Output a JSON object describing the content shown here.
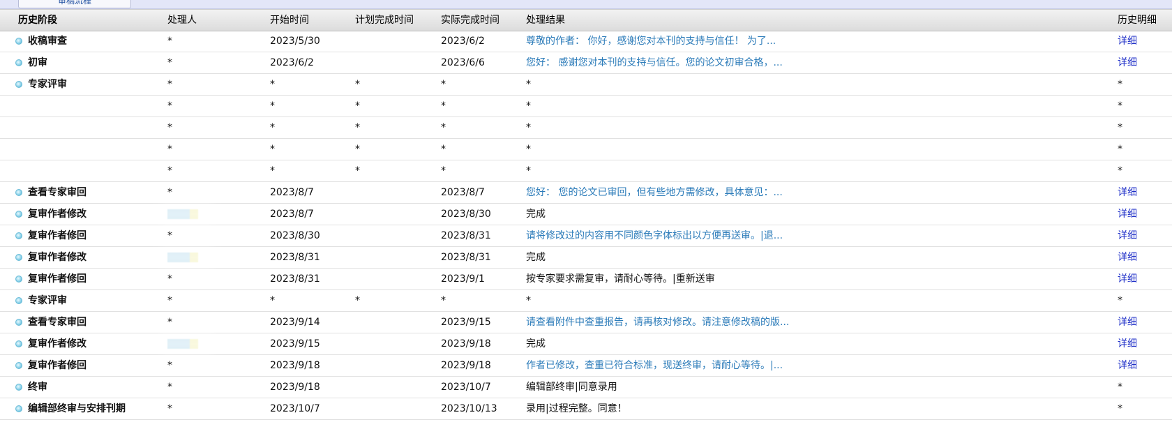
{
  "tabs": {
    "active_label": "审稿流程"
  },
  "columns": {
    "stage": "历史阶段",
    "handler": "处理人",
    "start": "开始时间",
    "planned": "计划完成时间",
    "actual": "实际完成时间",
    "result": "处理结果",
    "detail": "历史明细"
  },
  "rows": [
    {
      "stage": "收稿审查",
      "handler": "*",
      "start": "2023/5/30",
      "planned": "",
      "actual": "2023/6/2",
      "result": "尊敬的作者： 你好，感谢您对本刊的支持与信任！ 为了...",
      "result_link": true,
      "detail": "详细"
    },
    {
      "stage": "初审",
      "handler": "*",
      "start": "2023/6/2",
      "planned": "",
      "actual": "2023/6/6",
      "result": "您好： 感谢您对本刊的支持与信任。您的论文初审合格，...",
      "result_link": true,
      "detail": "详细"
    },
    {
      "stage": "专家评审",
      "handler": "*",
      "start": "*",
      "planned": "*",
      "actual": "*",
      "result": "*",
      "result_link": false,
      "detail": "*"
    },
    {
      "stage": "",
      "handler": "*",
      "start": "*",
      "planned": "*",
      "actual": "*",
      "result": "*",
      "result_link": false,
      "detail": "*"
    },
    {
      "stage": "",
      "handler": "*",
      "start": "*",
      "planned": "*",
      "actual": "*",
      "result": "*",
      "result_link": false,
      "detail": "*"
    },
    {
      "stage": "",
      "handler": "*",
      "start": "*",
      "planned": "*",
      "actual": "*",
      "result": "*",
      "result_link": false,
      "detail": "*"
    },
    {
      "stage": "",
      "handler": "*",
      "start": "*",
      "planned": "*",
      "actual": "*",
      "result": "*",
      "result_link": false,
      "detail": "*"
    },
    {
      "stage": "查看专家审回",
      "handler": "*",
      "start": "2023/8/7",
      "planned": "",
      "actual": "2023/8/7",
      "result": "您好： 您的论文已审回，但有些地方需修改，具体意见：...",
      "result_link": true,
      "detail": "详细"
    },
    {
      "stage": "复审作者修改",
      "handler": "",
      "handler_redacted": true,
      "start": "2023/8/7",
      "planned": "",
      "actual": "2023/8/30",
      "result": "完成",
      "result_link": false,
      "detail": "详细"
    },
    {
      "stage": "复审作者修回",
      "handler": "*",
      "start": "2023/8/30",
      "planned": "",
      "actual": "2023/8/31",
      "result": "请将修改过的内容用不同颜色字体标出以方便再送审。|退...",
      "result_link": true,
      "detail": "详细"
    },
    {
      "stage": "复审作者修改",
      "handler": "",
      "handler_redacted": true,
      "start": "2023/8/31",
      "planned": "",
      "actual": "2023/8/31",
      "result": "完成",
      "result_link": false,
      "detail": "详细"
    },
    {
      "stage": "复审作者修回",
      "handler": "*",
      "start": "2023/8/31",
      "planned": "",
      "actual": "2023/9/1",
      "result": "按专家要求需复审，请耐心等待。|重新送审",
      "result_link": false,
      "detail": "详细"
    },
    {
      "stage": "专家评审",
      "handler": "*",
      "start": "*",
      "planned": "*",
      "actual": "*",
      "result": "*",
      "result_link": false,
      "detail": "*"
    },
    {
      "stage": "查看专家审回",
      "handler": "*",
      "start": "2023/9/14",
      "planned": "",
      "actual": "2023/9/15",
      "result": "请查看附件中查重报告，请再核对修改。请注意修改稿的版...",
      "result_link": true,
      "detail": "详细"
    },
    {
      "stage": "复审作者修改",
      "handler": "",
      "handler_redacted": true,
      "start": "2023/9/15",
      "planned": "",
      "actual": "2023/9/18",
      "result": "完成",
      "result_link": false,
      "detail": "详细"
    },
    {
      "stage": "复审作者修回",
      "handler": "*",
      "start": "2023/9/18",
      "planned": "",
      "actual": "2023/9/18",
      "result": "作者已修改，查重已符合标准，现送终审，请耐心等待。|...",
      "result_link": true,
      "detail": "详细"
    },
    {
      "stage": "终审",
      "handler": "*",
      "start": "2023/9/18",
      "planned": "",
      "actual": "2023/10/7",
      "result": "编辑部终审|同意录用",
      "result_link": false,
      "detail": "*"
    },
    {
      "stage": "编辑部终审与安排刊期",
      "handler": "*",
      "start": "2023/10/7",
      "planned": "",
      "actual": "2023/10/13",
      "result": "录用|过程完整。同意！",
      "result_link": false,
      "detail": "*"
    }
  ]
}
